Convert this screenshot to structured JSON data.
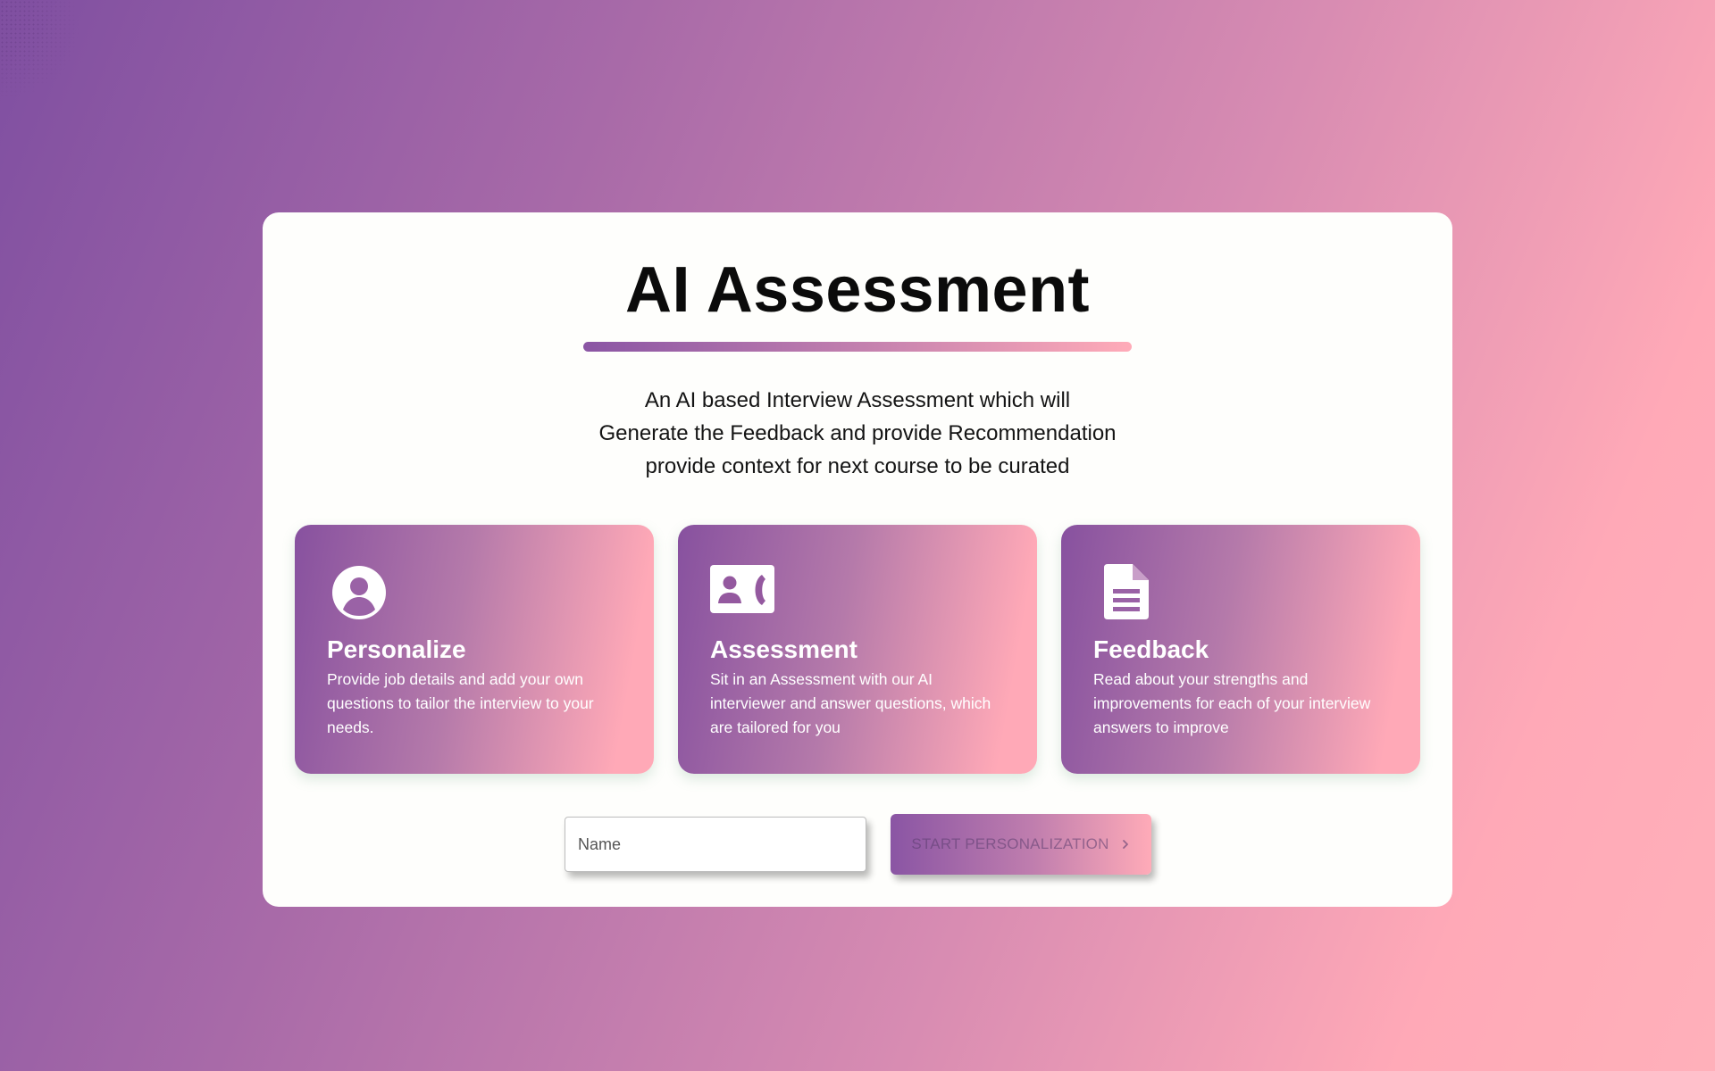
{
  "page": {
    "title": "AI Assessment",
    "description_lines": [
      "An AI based Interview Assessment which will",
      "Generate the Feedback and provide Recommendation",
      "provide context for next course to be curated"
    ]
  },
  "features": [
    {
      "icon": "user-circle-icon",
      "title": "Personalize",
      "text": "Provide job details and add your own questions to tailor the interview to your needs."
    },
    {
      "icon": "contact-call-icon",
      "title": "Assessment",
      "text": "Sit in an Assessment with our AI interviewer and answer questions, which are tailored for you"
    },
    {
      "icon": "document-icon",
      "title": "Feedback",
      "text": "Read about your strengths and improvements for each of your interview answers to improve"
    }
  ],
  "form": {
    "name_placeholder": "Name",
    "name_value": "",
    "start_label": "START PERSONALIZATION",
    "start_icon": "chevron-right-icon"
  },
  "colors": {
    "accent_start": "#8a55a4",
    "accent_end": "#ffabb8",
    "card_bg": "#fefefc"
  }
}
